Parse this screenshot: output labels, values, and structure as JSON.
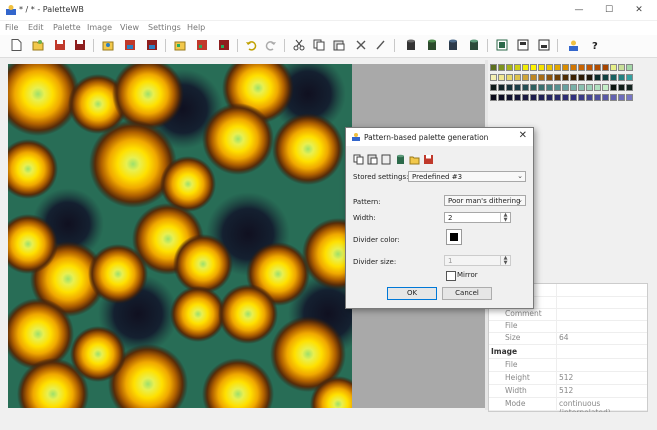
{
  "window": {
    "title": "* / * - PaletteWB"
  },
  "window_buttons": {
    "minimize": "—",
    "maximize": "☐",
    "close": "✕"
  },
  "menu": [
    "File",
    "Edit",
    "Palette",
    "Image",
    "View",
    "Settings",
    "Help"
  ],
  "toolbar_icons": [
    "new-icon",
    "open-icon",
    "save-icon",
    "save-as-icon",
    "open-image-icon",
    "save-image-icon",
    "save-image-as-icon",
    "import-palette-icon",
    "export-palette-icon",
    "export-palette-as-icon",
    "undo-icon",
    "redo-icon",
    "cut-icon",
    "copy-icon",
    "paste-icon",
    "delete-icon",
    "edit-icon",
    "cylinder-1-icon",
    "cylinder-2-icon",
    "cylinder-3-icon",
    "cylinder-4-icon",
    "palette-view-1-icon",
    "palette-view-2-icon",
    "palette-view-3-icon",
    "person-icon",
    "help-icon"
  ],
  "palette": {
    "rows": [
      [
        "#5b6f1f",
        "#7d931f",
        "#a4b21a",
        "#cfcf14",
        "#f2ec06",
        "#fff300",
        "#f4e200",
        "#e9c500",
        "#e0a600",
        "#d88c00",
        "#d07500",
        "#c86300",
        "#c05500",
        "#b04c00",
        "#a64400",
        "#e6ef88",
        "#c9df99",
        "#a3d7a8"
      ],
      [
        "#f5f0b4",
        "#f1e791",
        "#e7d86b",
        "#dcc24c",
        "#cfa538",
        "#bd8623",
        "#a86c14",
        "#8c530b",
        "#6c3e06",
        "#4d2c04",
        "#3a2103",
        "#2b1a05",
        "#1f1508",
        "#0b2b2b",
        "#104040",
        "#186060",
        "#238080",
        "#33a0a0"
      ],
      [
        "#0f1a1a",
        "#12242a",
        "#16303a",
        "#1b3d48",
        "#244e55",
        "#2e6060",
        "#387070",
        "#448080",
        "#559090",
        "#66a0a0",
        "#78b0a8",
        "#8ac0b0",
        "#9cd0b8",
        "#b0e0c0",
        "#c4f0c8",
        "#0c1410",
        "#101c18",
        "#142420"
      ],
      [
        "#0a0a1a",
        "#0c0c24",
        "#10102e",
        "#141438",
        "#181842",
        "#1c1c4c",
        "#202056",
        "#242460",
        "#28286a",
        "#2c2c74",
        "#30307e",
        "#3a3a88",
        "#444492",
        "#4e4e9c",
        "#5858a6",
        "#6262b0",
        "#6c6cba",
        "#7676c4"
      ]
    ]
  },
  "properties": {
    "rows": [
      {
        "label": "",
        "value": ""
      },
      {
        "label": "",
        "value": ""
      },
      {
        "label": "Comment",
        "value": ""
      },
      {
        "label": "File",
        "value": ""
      },
      {
        "label": "Size",
        "value": "64"
      }
    ],
    "image_section": "Image",
    "image_rows": [
      {
        "label": "File",
        "value": ""
      },
      {
        "label": "Height",
        "value": "512"
      },
      {
        "label": "Width",
        "value": "512"
      },
      {
        "label": "Mode",
        "value": "continuous (interpolated)"
      }
    ]
  },
  "dialog": {
    "title": "Pattern-based palette generation",
    "toolbar_icons": [
      "copy-icon",
      "paste-icon",
      "paste-special-icon",
      "cylinder-icon",
      "open-folder-icon",
      "save-icon"
    ],
    "stored_settings_label": "Stored settings:",
    "stored_settings_value": "Predefined #3",
    "pattern_label": "Pattern:",
    "pattern_value": "Poor man's dithering",
    "width_label": "Width:",
    "width_value": "2",
    "divider_color_label": "Divider color:",
    "divider_color_value": "#000000",
    "divider_size_label": "Divider size:",
    "divider_size_value": "1",
    "mirror_label": "Mirror",
    "mirror_checked": false,
    "ok_label": "OK",
    "cancel_label": "Cancel"
  }
}
